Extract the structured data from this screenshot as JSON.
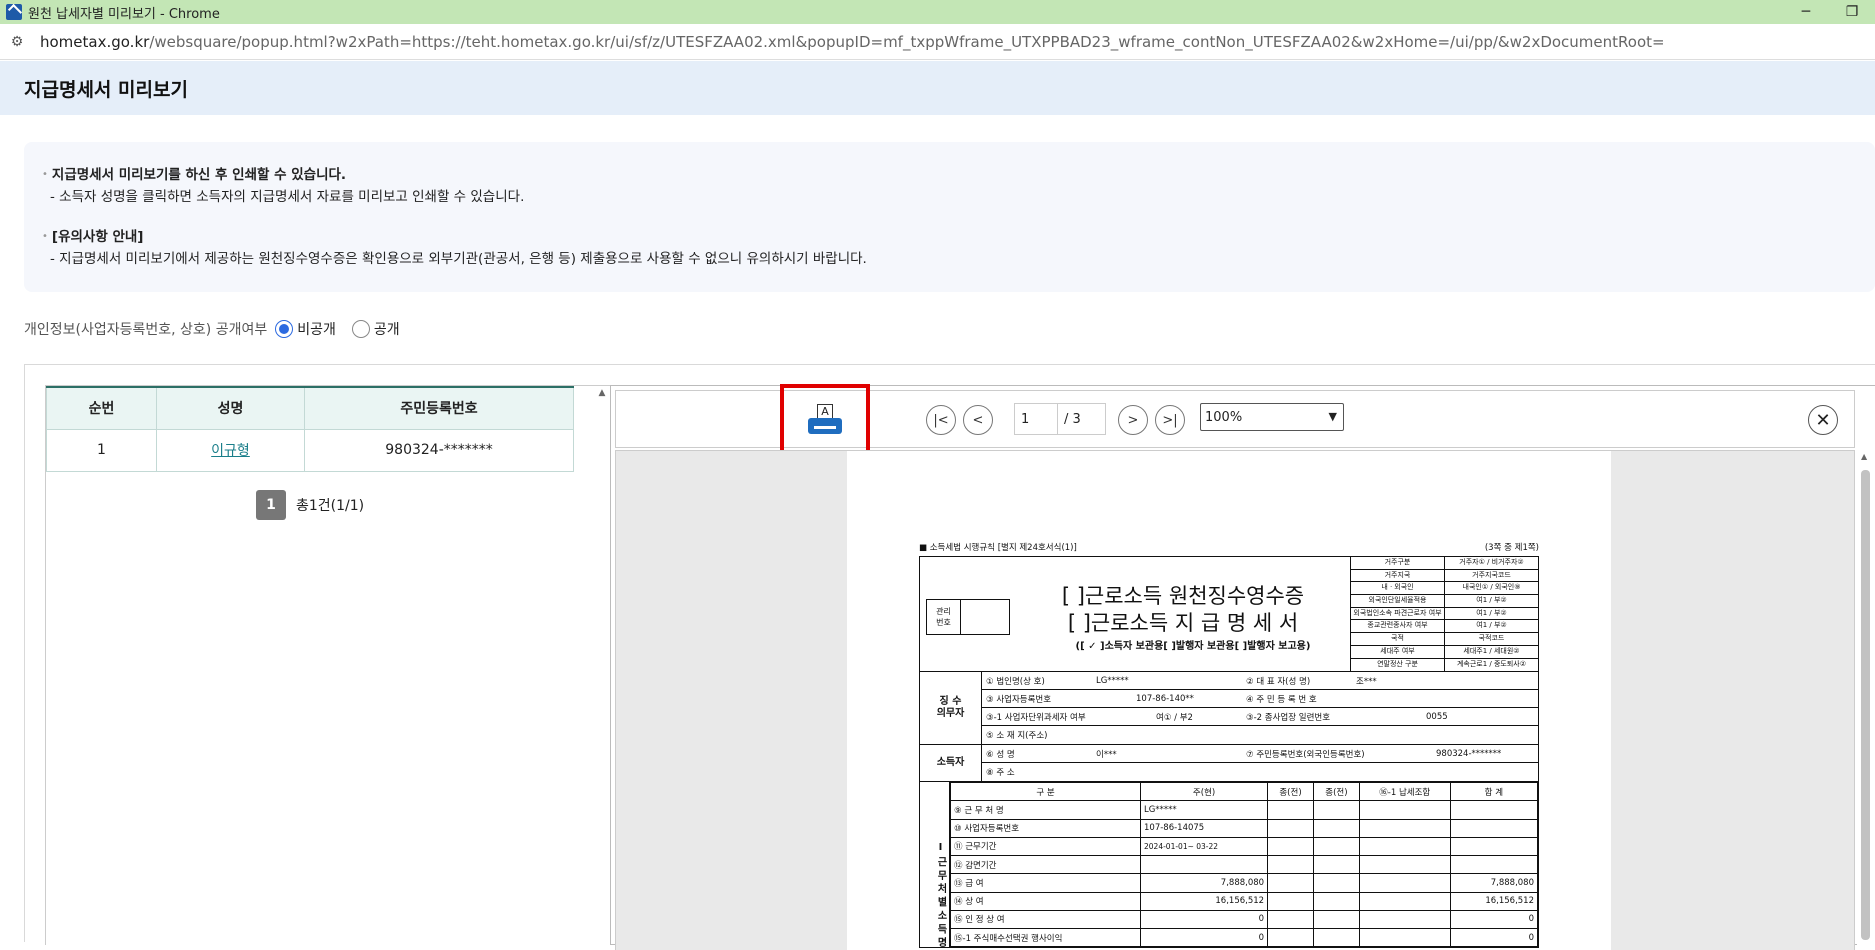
{
  "window": {
    "title": "원천 납세자별 미리보기 - Chrome"
  },
  "address": {
    "host": "hometax.go.kr",
    "path": "/websquare/popup.html?w2xPath=https://teht.hometax.go.kr/ui/sf/z/UTESFZAA02.xml&popupID=mf_txppWframe_UTXPPBAD23_wframe_contNon_UTESFZAA02&w2xHome=/ui/pp/&w2xDocumentRoot="
  },
  "header": {
    "title": "지급명세서 미리보기"
  },
  "notice": {
    "line1": "지급명세서 미리보기를 하신 후 인쇄할 수 있습니다.",
    "line2": "- 소득자 성명을 클릭하면 소득자의 지급명세서 자료를 미리보고 인쇄할 수 있습니다.",
    "line3": "[유의사항 안내]",
    "line4": "- 지급명세서 미리보기에서 제공하는 원천징수영수증은 확인용으로 외부기관(관공서, 은행 등) 제출용으로 사용할 수 없으니 유의하시기 바랍니다."
  },
  "privacy": {
    "label": "개인정보(사업자등록번호, 상호) 공개여부",
    "opt_private": "비공개",
    "opt_public": "공개",
    "selected": "비공개"
  },
  "grid": {
    "headers": [
      "순번",
      "성명",
      "주민등록번호"
    ],
    "rows": [
      {
        "no": "1",
        "name": "이규형",
        "rrn": "980324-*******"
      }
    ],
    "page": "1",
    "total": "총1건(1/1)"
  },
  "viewer": {
    "print_icon_letter": "A",
    "page_current": "1",
    "page_total": "/ 3",
    "zoom": "100%",
    "icons": {
      "print": "printer-icon",
      "first": "first-page-icon",
      "prev": "prev-page-icon",
      "next": "next-page-icon",
      "last": "last-page-icon",
      "close": "close-icon"
    }
  },
  "doc": {
    "law": "■ 소득세법 시행규칙 [별지 제24호서식(1)]",
    "pages": "(3쪽 중 제1쪽)",
    "mgmt": "관리\n번호",
    "title1": "[ ]근로소득 원천징수영수증",
    "title2": "[ ]근로소득 지 급 명 세 서",
    "sub": "([ ✓ ]소득자 보관용[    ]발행자 보관용[    ]발행자 보고용)",
    "side": [
      [
        "거주구분",
        "거주자① / 비거주자②"
      ],
      [
        "거주지국",
        "거주지국코드"
      ],
      [
        "내ㆍ외국인",
        "내국인① / 외국인⑨"
      ],
      [
        "외국인단일세율적용",
        "여1 / 부②"
      ],
      [
        "외국법인소속 파견근로자 여부",
        "여1 / 부②"
      ],
      [
        "종교관련종사자 여부",
        "여1 / 부②"
      ],
      [
        "국적",
        "국적코드"
      ],
      [
        "세대주 여부",
        "세대주1 / 세대원②"
      ],
      [
        "연말정산 구분",
        "계속근로1 / 중도퇴사②"
      ]
    ],
    "payer_head": "징 수\n의무자",
    "payer": {
      "r1a": "① 법인명(상 호)",
      "r1a_v": "LG*****",
      "r1b": "② 대 표 자(성 명)",
      "r1b_v": "조***",
      "r2a": "③ 사업자등록번호",
      "r2a_v": "107-86-140**",
      "r2b": "④ 주 민 등 록 번 호",
      "r3a": "③-1 사업자단위과세자 여부",
      "r3a_v": "여① / 부2",
      "r3b": "③-2 종사업장 일련번호",
      "r3b_v": "0055",
      "r4": "⑤ 소 재 지(주소)"
    },
    "earner_head": "소득자",
    "earner": {
      "r1a": "⑥ 성          명",
      "r1a_v": "이***",
      "r1b": "⑦ 주민등록번호(외국인등록번호)",
      "r1b_v": "980324-*******",
      "r2": "⑧ 주          소"
    },
    "income_head": "Ⅰ 근 무 처 별 소 득 명",
    "income_cols": [
      "구 분",
      "주(현)",
      "종(전)",
      "종(전)",
      "⑯-1 납세조합",
      "합 계"
    ],
    "income_rows": [
      [
        "⑨ 근 무 처 명",
        "LG*****",
        "",
        "",
        "",
        ""
      ],
      [
        "⑩ 사업자등록번호",
        "107-86-14075",
        "",
        "",
        "",
        ""
      ],
      [
        "⑪ 근무기간",
        "2024-01-01~ 03-22",
        "",
        "",
        "",
        ""
      ],
      [
        "⑫ 감면기간",
        "",
        "",
        "",
        "",
        ""
      ],
      [
        "⑬ 급          여",
        "7,888,080",
        "",
        "",
        "",
        "7,888,080"
      ],
      [
        "⑭ 상          여",
        "16,156,512",
        "",
        "",
        "",
        "16,156,512"
      ],
      [
        "⑮ 인 정 상 여",
        "0",
        "",
        "",
        "",
        "0"
      ],
      [
        "⑮-1 주식매수선택권 행사이익",
        "0",
        "",
        "",
        "",
        "0"
      ]
    ]
  }
}
